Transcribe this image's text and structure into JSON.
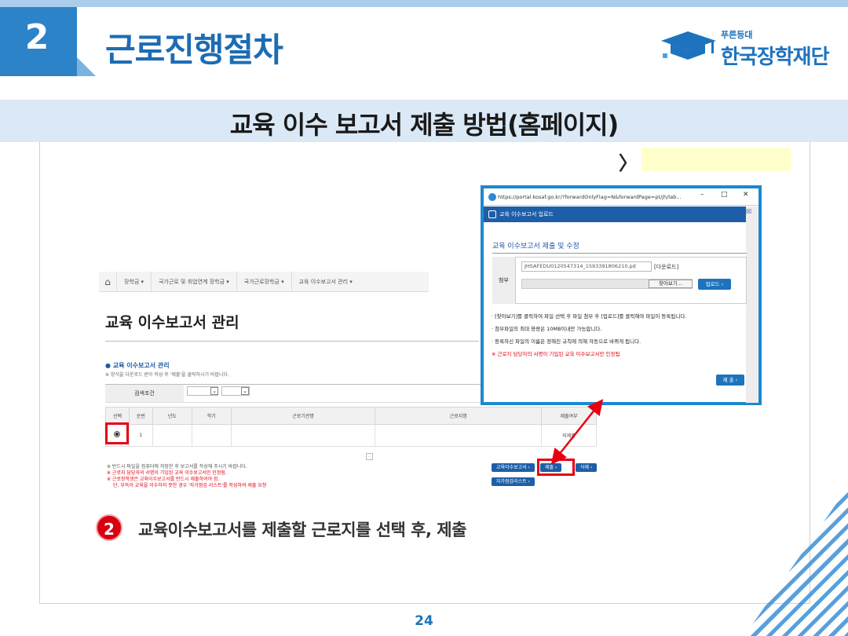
{
  "section": {
    "number": "2",
    "title": "근로진행절차"
  },
  "logo": {
    "small": "푸른등대",
    "name": "한국장학재단",
    "accent": "#1e73be"
  },
  "subtitle": "교육 이수 보고서 제출 방법(홈페이지)",
  "top_hint": {
    "chevron": "〉"
  },
  "site": {
    "nav": {
      "home_icon": "home-icon",
      "items": [
        "장학금 ▾",
        "국가근로 및 취업연계 장학금 ▾",
        "국가근로장학금 ▾",
        "교육 이수보고서 관리 ▾"
      ]
    },
    "page_title": "교육 이수보고서 관리",
    "mgmt_title": "● 교육 이수보고서 관리",
    "mgmt_sub": "※ 양식을 다운로드 받아 작성 후 '제출'을 클릭하시기 바랍니다.",
    "search_label": "검색조건",
    "table": {
      "headers": [
        "선택",
        "순번",
        "년도",
        "학기",
        "근로기관명",
        "근로지명",
        "제출여부"
      ],
      "rows": [
        {
          "seq": "1",
          "year": "",
          "term": "",
          "org": "",
          "site": "",
          "status": "미제출"
        }
      ]
    },
    "notes": [
      "※ 반드시 파일을 컴퓨터에 저장한 후 보고서를 작성해 주시기 바랍니다.",
      "※ 근로지 담당자의 서명이 기입된 교육 이수보고서만 인정됨.",
      "※ 근로장학생은 교육이수보고서를 반드시 제출하여야 함.",
      "단, 부득이 교육을 이수하지 못한 경우 '자가점검 리스트'를 작성하여 제출 요청"
    ],
    "buttons": {
      "report": "교육이수보고서 ›",
      "submit": "제출 ›",
      "delete": "삭제 ›",
      "checklist": "자가점검리스트 ›"
    }
  },
  "popup": {
    "url": "https://portal.kosaf.go.kr/?forwardOnlyFlag=N&forwardPage=pt/jh/lab...",
    "window_controls": {
      "minimize": "–",
      "maximize": "□",
      "close": "✕"
    },
    "header": "교육 이수보고서 업로드",
    "header_close": "☒",
    "title": "교육 이수보고서 제출 및 수정",
    "attach_label": "첨부",
    "file_name": "JHSAFEDU0120547314_1593391806210.pd",
    "download": "[다운로드]",
    "browse": "찾아보기...",
    "upload": "업로드 ›",
    "notes": [
      "· [찾아보기]를 클릭하여 파일 선택 후 파일 첨부 후 [업로드]를 클릭해야 파일이 등록됩니다.",
      "· 첨부파일의 최대 용량은 10MB이내만 가능합니다.",
      "· 등록하신 파일의 이름은 정해진 규칙에 의해 자동으로 바뀌게 됩니다."
    ],
    "warning": "※ 근로지 담당자의 서명이 기입된 교육 이수보고서만 인정됨",
    "submit": "제 출 ›"
  },
  "step": {
    "number": "2",
    "text": "교육이수보고서를 제출할 근로지를 선택 후, 제출"
  },
  "page_number": "24"
}
